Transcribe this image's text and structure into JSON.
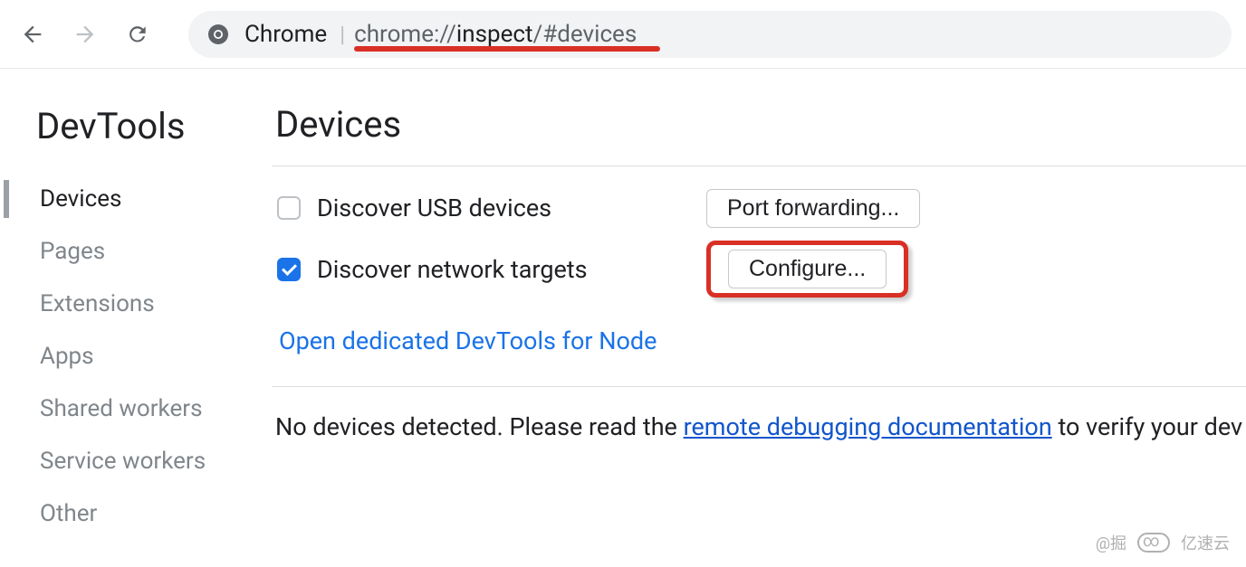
{
  "toolbar": {
    "address_label": "Chrome",
    "url_scheme": "chrome://",
    "url_path_dark": "inspect",
    "url_path_rest": "/#devices"
  },
  "sidebar": {
    "title": "DevTools",
    "items": [
      {
        "label": "Devices",
        "active": true
      },
      {
        "label": "Pages",
        "active": false
      },
      {
        "label": "Extensions",
        "active": false
      },
      {
        "label": "Apps",
        "active": false
      },
      {
        "label": "Shared workers",
        "active": false
      },
      {
        "label": "Service workers",
        "active": false
      },
      {
        "label": "Other",
        "active": false
      }
    ]
  },
  "main": {
    "title": "Devices",
    "discover_usb": {
      "label": "Discover USB devices",
      "checked": false
    },
    "discover_net": {
      "label": "Discover network targets",
      "checked": true
    },
    "port_forwarding_btn": "Port forwarding...",
    "configure_btn": "Configure...",
    "node_link": "Open dedicated DevTools for Node",
    "no_devices_prefix": "No devices detected. Please read the ",
    "doc_link": "remote debugging documentation",
    "no_devices_suffix": " to verify your dev"
  },
  "watermark": {
    "left": "@掘",
    "right": "亿速云"
  }
}
